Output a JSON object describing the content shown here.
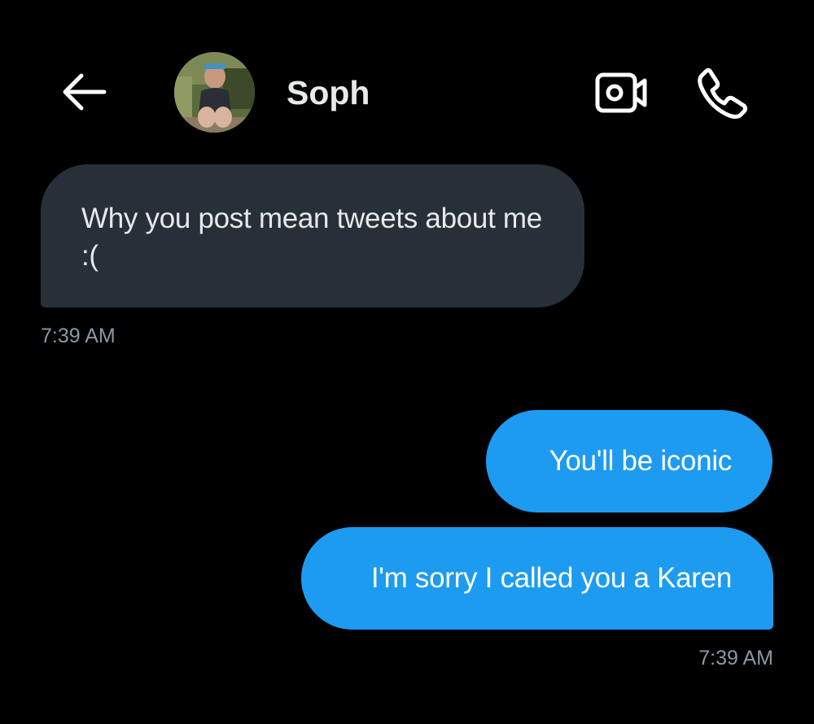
{
  "header": {
    "contact_name": "Soph",
    "back_icon": "arrow-left-icon",
    "video_icon": "video-camera-icon",
    "call_icon": "phone-icon"
  },
  "messages": [
    {
      "direction": "incoming",
      "text": "Why you post mean tweets about me :(",
      "time": "7:39 AM"
    },
    {
      "direction": "outgoing",
      "text": "You'll be iconic"
    },
    {
      "direction": "outgoing",
      "text": "I'm sorry I called you a Karen",
      "time": "7:39 AM"
    }
  ],
  "colors": {
    "background": "#000000",
    "incoming_bubble": "#273039",
    "outgoing_bubble": "#1d9bf0",
    "timestamp": "#8b98a5",
    "text_primary": "#e7e9ea"
  }
}
